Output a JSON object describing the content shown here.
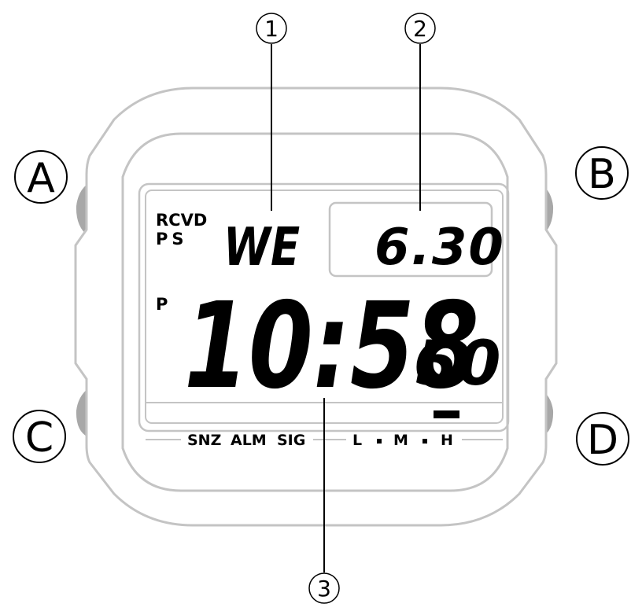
{
  "callouts": [
    {
      "num": "1"
    },
    {
      "num": "2"
    },
    {
      "num": "3"
    }
  ],
  "buttons": [
    {
      "letter": "A"
    },
    {
      "letter": "B"
    },
    {
      "letter": "C"
    },
    {
      "letter": "D"
    }
  ],
  "indicators": {
    "rcvd": "RCVD",
    "ps": "PS",
    "pm": "P"
  },
  "display": {
    "day": "WE",
    "date": "6.30",
    "time": "10:58",
    "seconds": "50"
  },
  "bottom_labels": {
    "snz": "SNZ",
    "alm": "ALM",
    "sig": "SIG",
    "l": "L",
    "m": "M",
    "h": "H",
    "level_selected": "H"
  },
  "colors": {
    "outline": "#c4c4c4",
    "buttons": "#a8a8a8",
    "ink": "#000000"
  }
}
